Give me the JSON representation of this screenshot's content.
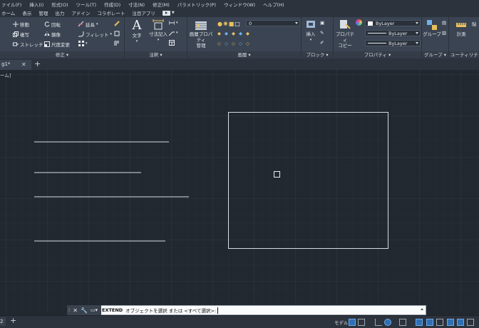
{
  "menu": [
    "ァイル(F)",
    "挿入(I)",
    "形式(O)",
    "ツール(T)",
    "作成(D)",
    "寸法(N)",
    "修正(M)",
    "パラメトリック(P)",
    "ウィンドウ(W)",
    "ヘルプ(H)"
  ],
  "ribbon_tabs": [
    "ホーム",
    "表示",
    "管理",
    "出力",
    "アドイン",
    "コラボレート",
    "注目アプリ"
  ],
  "modify_panel": {
    "move": "移動",
    "rotate": "回転",
    "copy": "複写",
    "mirror": "鏡像",
    "stretch": "ストレッチ",
    "scale": "尺度変更",
    "extend": "延長",
    "fillet": "フィレット",
    "title": "修正"
  },
  "annotation_panel": {
    "text": "文字",
    "dimension": "寸法記入",
    "title": "注釈"
  },
  "layer_panel": {
    "layer_props_1": "画層プロパティ",
    "layer_props_2": "管理",
    "layer_value": "0",
    "title": "画層"
  },
  "block_panel": {
    "insert": "挿入",
    "title": "ブロック"
  },
  "properties_panel": {
    "match_1": "プロパティ",
    "match_2": "コピー",
    "color": "ByLayer",
    "title": "プロパティ"
  },
  "group_panel": {
    "group": "グループ",
    "title": "グループ"
  },
  "utility_panel": {
    "measure": "計測",
    "title": "ユーティリティ"
  },
  "paste_label": "貼",
  "file_tab": {
    "name": "g1*"
  },
  "view_label": "ーム]",
  "command": {
    "name": "EXTEND",
    "prompt": "オブジェクトを選択  または <すべて選択>:"
  },
  "status": {
    "layout_num": "2",
    "model": "モデル"
  },
  "colors": {
    "canvas": "#212830",
    "ribbon": "#3b4452",
    "accent": "#2f6fb3",
    "geometry": "#d7dce2"
  }
}
